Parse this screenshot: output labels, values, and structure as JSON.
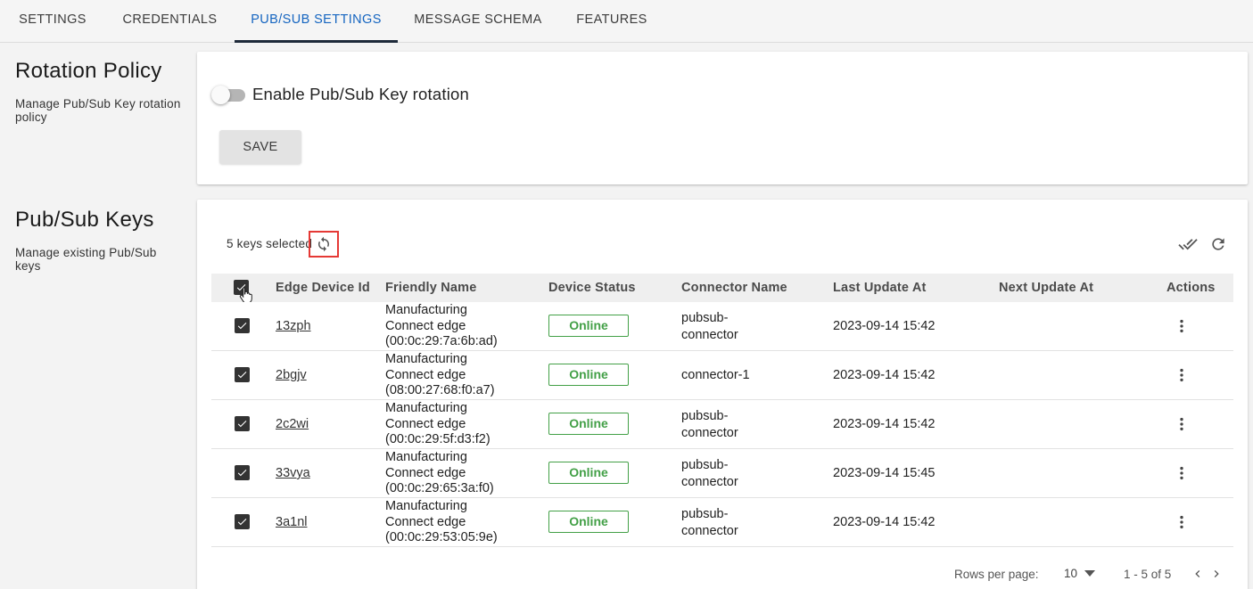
{
  "tabs": [
    {
      "label": "SETTINGS"
    },
    {
      "label": "CREDENTIALS"
    },
    {
      "label": "PUB/SUB SETTINGS"
    },
    {
      "label": "MESSAGE SCHEMA"
    },
    {
      "label": "FEATURES"
    }
  ],
  "active_tab": "PUB/SUB SETTINGS",
  "rotation": {
    "title": "Rotation Policy",
    "desc_line1": "Manage Pub/Sub Key rotation",
    "desc_line2": "policy",
    "toggle_label": "Enable Pub/Sub Key rotation",
    "toggle_on": false,
    "save_label": "SAVE"
  },
  "keys": {
    "title": "Pub/Sub Keys",
    "desc_line1": "Manage existing Pub/Sub",
    "desc_line2": "keys",
    "selected_text": "5 keys selected",
    "icons": {
      "rotate": "rotate-icon",
      "approve_all": "double-check-icon",
      "refresh": "refresh-icon"
    }
  },
  "table": {
    "headers": {
      "edge_device_id": "Edge Device Id",
      "friendly_name": "Friendly Name",
      "device_status": "Device Status",
      "connector_name": "Connector Name",
      "last_update_at": "Last Update At",
      "next_update_at": "Next Update At",
      "actions": "Actions"
    },
    "rows": [
      {
        "id": "13zph",
        "name1": "Manufacturing",
        "name2": "Connect edge",
        "name3": "(00:0c:29:7a:6b:ad)",
        "status": "Online",
        "conn1": "pubsub-",
        "conn2": "connector",
        "last_update": "2023-09-14 15:42",
        "next_update": "",
        "checked": true
      },
      {
        "id": "2bgjv",
        "name1": "Manufacturing",
        "name2": "Connect edge",
        "name3": "(08:00:27:68:f0:a7)",
        "status": "Online",
        "conn1": "connector-1",
        "conn2": "",
        "last_update": "2023-09-14 15:42",
        "next_update": "",
        "checked": true
      },
      {
        "id": "2c2wi",
        "name1": "Manufacturing",
        "name2": "Connect edge",
        "name3": "(00:0c:29:5f:d3:f2)",
        "status": "Online",
        "conn1": "pubsub-",
        "conn2": "connector",
        "last_update": "2023-09-14 15:42",
        "next_update": "",
        "checked": true
      },
      {
        "id": "33vya",
        "name1": "Manufacturing",
        "name2": "Connect edge",
        "name3": "(00:0c:29:65:3a:f0)",
        "status": "Online",
        "conn1": "pubsub-",
        "conn2": "connector",
        "last_update": "2023-09-14 15:45",
        "next_update": "",
        "checked": true
      },
      {
        "id": "3a1nl",
        "name1": "Manufacturing",
        "name2": "Connect edge",
        "name3": "(00:0c:29:53:05:9e)",
        "status": "Online",
        "conn1": "pubsub-",
        "conn2": "connector",
        "last_update": "2023-09-14 15:42",
        "next_update": "",
        "checked": true
      }
    ]
  },
  "pagination": {
    "rows_per_page_label": "Rows per page:",
    "rows_per_page_value": "10",
    "range_text": "1 - 5 of 5"
  },
  "colors": {
    "accent": "#1565c0",
    "online": "#43a047",
    "highlight_border": "#e53935"
  }
}
